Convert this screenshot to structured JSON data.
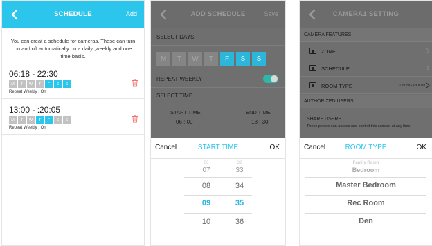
{
  "screen1": {
    "header": {
      "title": "SCHEDULE",
      "action": "Add"
    },
    "intro": "You can creat a schedule for cameras. These can turn on and off automatically on a daily ,weekly and one time basis.",
    "schedules": [
      {
        "time": "06:18 - 22:30",
        "repeat": "Repeat Weekly : On",
        "days": [
          {
            "label": "M",
            "on": false
          },
          {
            "label": "T",
            "on": false
          },
          {
            "label": "W",
            "on": false
          },
          {
            "label": "T",
            "on": false
          },
          {
            "label": "F",
            "on": true
          },
          {
            "label": "S",
            "on": true
          },
          {
            "label": "S",
            "on": true
          }
        ]
      },
      {
        "time": "13:00 - :20:05",
        "repeat": "Repeat Weekly : On",
        "days": [
          {
            "label": "M",
            "on": false
          },
          {
            "label": "T",
            "on": false
          },
          {
            "label": "W",
            "on": false
          },
          {
            "label": "T",
            "on": true
          },
          {
            "label": "F",
            "on": true
          },
          {
            "label": "S",
            "on": false
          },
          {
            "label": "S",
            "on": false
          }
        ]
      }
    ]
  },
  "screen2": {
    "header": {
      "title": "ADD SCHEDULE",
      "action": "Save"
    },
    "select_days_label": "SELECT DAYS",
    "days": [
      {
        "label": "M",
        "on": false
      },
      {
        "label": "T",
        "on": false
      },
      {
        "label": "W",
        "on": false
      },
      {
        "label": "T",
        "on": false
      },
      {
        "label": "F",
        "on": true
      },
      {
        "label": "S",
        "on": true
      },
      {
        "label": "S",
        "on": true
      }
    ],
    "repeat_weekly_label": "REPEAT WEEKLY",
    "repeat_weekly_on": true,
    "select_time_label": "SELECT TIME",
    "start_time_label": "START TIME",
    "start_time_value": "06 : 00",
    "end_time_label": "END TIME",
    "end_time_value": "18 : 30",
    "sheet": {
      "cancel": "Cancel",
      "title": "START TIME",
      "ok": "OK"
    },
    "picker": {
      "hours": [
        "06",
        "07",
        "08",
        "09",
        "10"
      ],
      "minutes": [
        "32",
        "33",
        "34",
        "35",
        "36"
      ],
      "selected_hour": "09",
      "selected_minute": "35"
    }
  },
  "screen3": {
    "header": {
      "title": "CAMERA1 SETTING"
    },
    "camera_features_label": "CAMERA FEATURES",
    "rows": [
      {
        "label": "ZONE",
        "value": ""
      },
      {
        "label": "SCHEDULE",
        "value": ""
      },
      {
        "label": "ROOM TYPE",
        "value": "LIVING ROOM"
      }
    ],
    "authorized_users_label": "AUTHORIZED USERS",
    "share_users_title": "SHARE USERS",
    "share_users_desc": "These people can access and control this camera at any time",
    "sheet": {
      "cancel": "Cancel",
      "title": "ROOM TYPE",
      "ok": "OK"
    },
    "picker": {
      "options": [
        "Family Room",
        "Bedroom",
        "Master Bedroom",
        "Rec Room",
        "Den"
      ],
      "selected": "Rec Room"
    }
  },
  "colors": {
    "accent": "#2cc6ec",
    "delete": "#f0726f",
    "toggle": "#2eb7a7"
  }
}
